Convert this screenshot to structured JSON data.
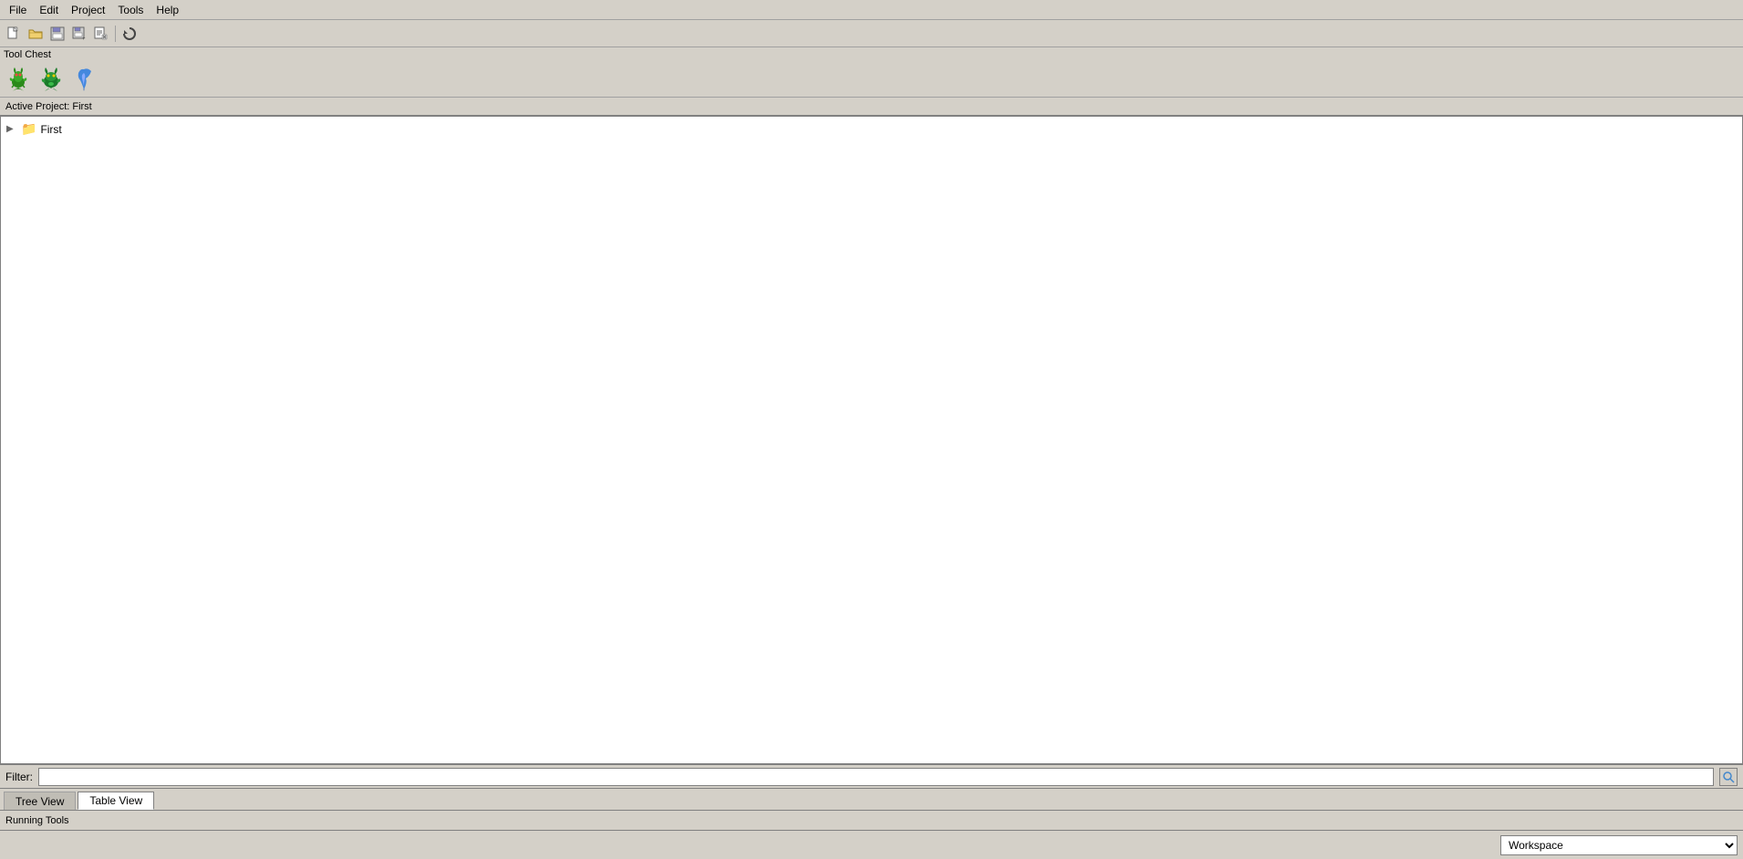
{
  "menubar": {
    "items": [
      {
        "label": "File",
        "id": "file"
      },
      {
        "label": "Edit",
        "id": "edit"
      },
      {
        "label": "Project",
        "id": "project"
      },
      {
        "label": "Tools",
        "id": "tools"
      },
      {
        "label": "Help",
        "id": "help"
      }
    ]
  },
  "toolbar": {
    "buttons": [
      {
        "id": "new",
        "icon": "📄",
        "tooltip": "New"
      },
      {
        "id": "open-folder",
        "icon": "📂",
        "tooltip": "Open Folder"
      },
      {
        "id": "save",
        "icon": "💾",
        "tooltip": "Save"
      },
      {
        "id": "save-as",
        "icon": "📁",
        "tooltip": "Save As"
      },
      {
        "id": "close",
        "icon": "✂️",
        "tooltip": "Close"
      },
      {
        "id": "refresh",
        "icon": "🔄",
        "tooltip": "Refresh"
      }
    ]
  },
  "toolchest": {
    "label": "Tool Chest",
    "tools": [
      {
        "id": "dragon1",
        "label": "Dragon Tool 1"
      },
      {
        "id": "dragon2",
        "label": "Dragon Tool 2"
      },
      {
        "id": "tool3",
        "label": "Tool 3"
      }
    ]
  },
  "activeproject": {
    "label": "Active Project: First"
  },
  "tree": {
    "items": [
      {
        "id": "first",
        "label": "First",
        "type": "folder",
        "expanded": false
      }
    ]
  },
  "filter": {
    "label": "Filter:",
    "placeholder": "",
    "value": ""
  },
  "tabs": [
    {
      "id": "tree-view",
      "label": "Tree View",
      "active": false
    },
    {
      "id": "table-view",
      "label": "Table View",
      "active": true
    }
  ],
  "runningtools": {
    "label": "Running Tools"
  },
  "statusbar": {
    "workspace_label": "Workspace",
    "workspace_options": [
      "Workspace"
    ]
  }
}
